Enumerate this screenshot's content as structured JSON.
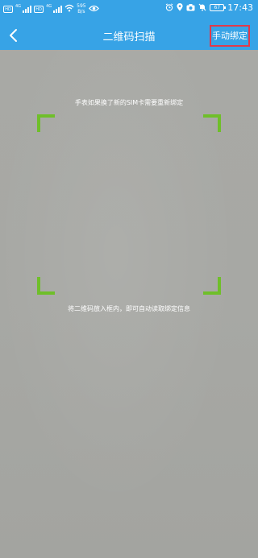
{
  "status_bar": {
    "sim1_badge": "HD",
    "sim1_network": "4G",
    "sim2_badge": "HD",
    "sim2_network": "4G",
    "net_speed_value": "595",
    "net_speed_unit": "B/s",
    "battery_level": "67",
    "time": "17:43",
    "icons": [
      "wifi-icon",
      "eye-icon",
      "alarm-icon",
      "location-icon",
      "camera-icon",
      "mute-icon",
      "battery-icon"
    ]
  },
  "nav": {
    "back_icon": "chevron-left-icon",
    "title": "二维码扫描",
    "manual_bind_label": "手动绑定"
  },
  "scanner": {
    "top_hint": "手表如果换了新的SIM卡需要重新绑定",
    "bottom_hint": "将二维码放入框内，即可自动读取绑定信息",
    "frame_color": "#6fbf2a"
  },
  "colors": {
    "header": "#37a3e6",
    "highlight_border": "#e03a4b",
    "camera_bg": "#a9aaa6"
  }
}
